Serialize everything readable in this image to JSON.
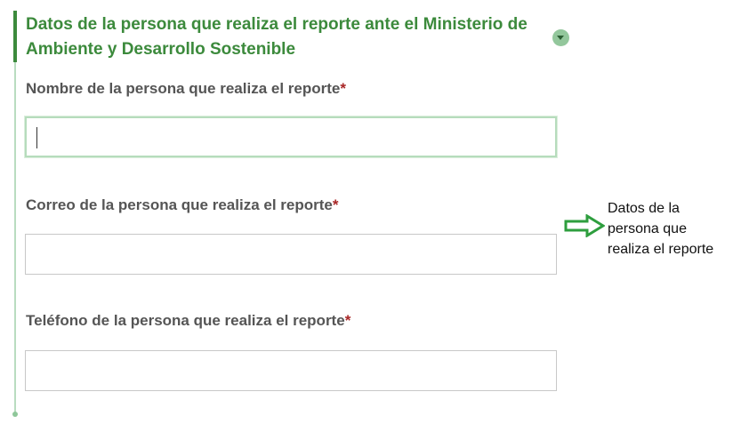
{
  "section": {
    "title": "Datos de la persona que realiza el reporte ante el Ministerio de Ambiente y Desarrollo Sostenible",
    "collapse_icon": "chevron-down-icon"
  },
  "fields": {
    "name": {
      "label": "Nombre de la persona que realiza el reporte",
      "required_mark": "*",
      "value": "",
      "focused": true
    },
    "email": {
      "label": "Correo de la persona que realiza el reporte",
      "required_mark": "*",
      "value": ""
    },
    "phone": {
      "label": "Teléfono de la persona que realiza el reporte",
      "required_mark": "*",
      "value": ""
    }
  },
  "annotation": {
    "arrow_icon": "right-arrow-icon",
    "text_lines": [
      "Datos de la",
      "persona que",
      "realiza el reporte"
    ],
    "arrow_color": "#2e9e3e"
  },
  "colors": {
    "accent": "#3c8a3c",
    "required": "#a82626",
    "label": "#555555"
  }
}
